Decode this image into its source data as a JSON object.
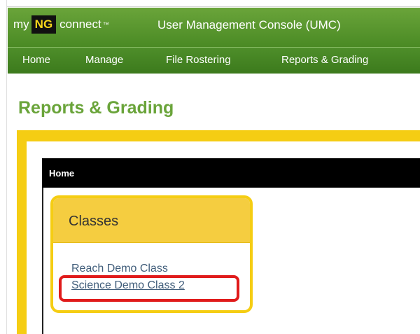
{
  "brand": {
    "my": "my",
    "ng": "NG",
    "connect": "connect",
    "trademark": "™",
    "app_title": "User Management Console (UMC)"
  },
  "nav": {
    "items": [
      {
        "label": "Home"
      },
      {
        "label": "Manage"
      },
      {
        "label": "File Rostering"
      },
      {
        "label": "Reports & Grading"
      }
    ]
  },
  "page": {
    "title": "Reports & Grading"
  },
  "breadcrumb": {
    "label": "Home"
  },
  "classes_card": {
    "title": "Classes",
    "links": [
      {
        "label": "Reach Demo Class"
      },
      {
        "label": "Science Demo Class 2"
      }
    ]
  },
  "colors": {
    "brand_green": "#6aa43a",
    "nav_green": "#4e8e2a",
    "accent_yellow": "#f5cd13",
    "highlight_red": "#e01b1b",
    "link_blue": "#405d7a"
  }
}
